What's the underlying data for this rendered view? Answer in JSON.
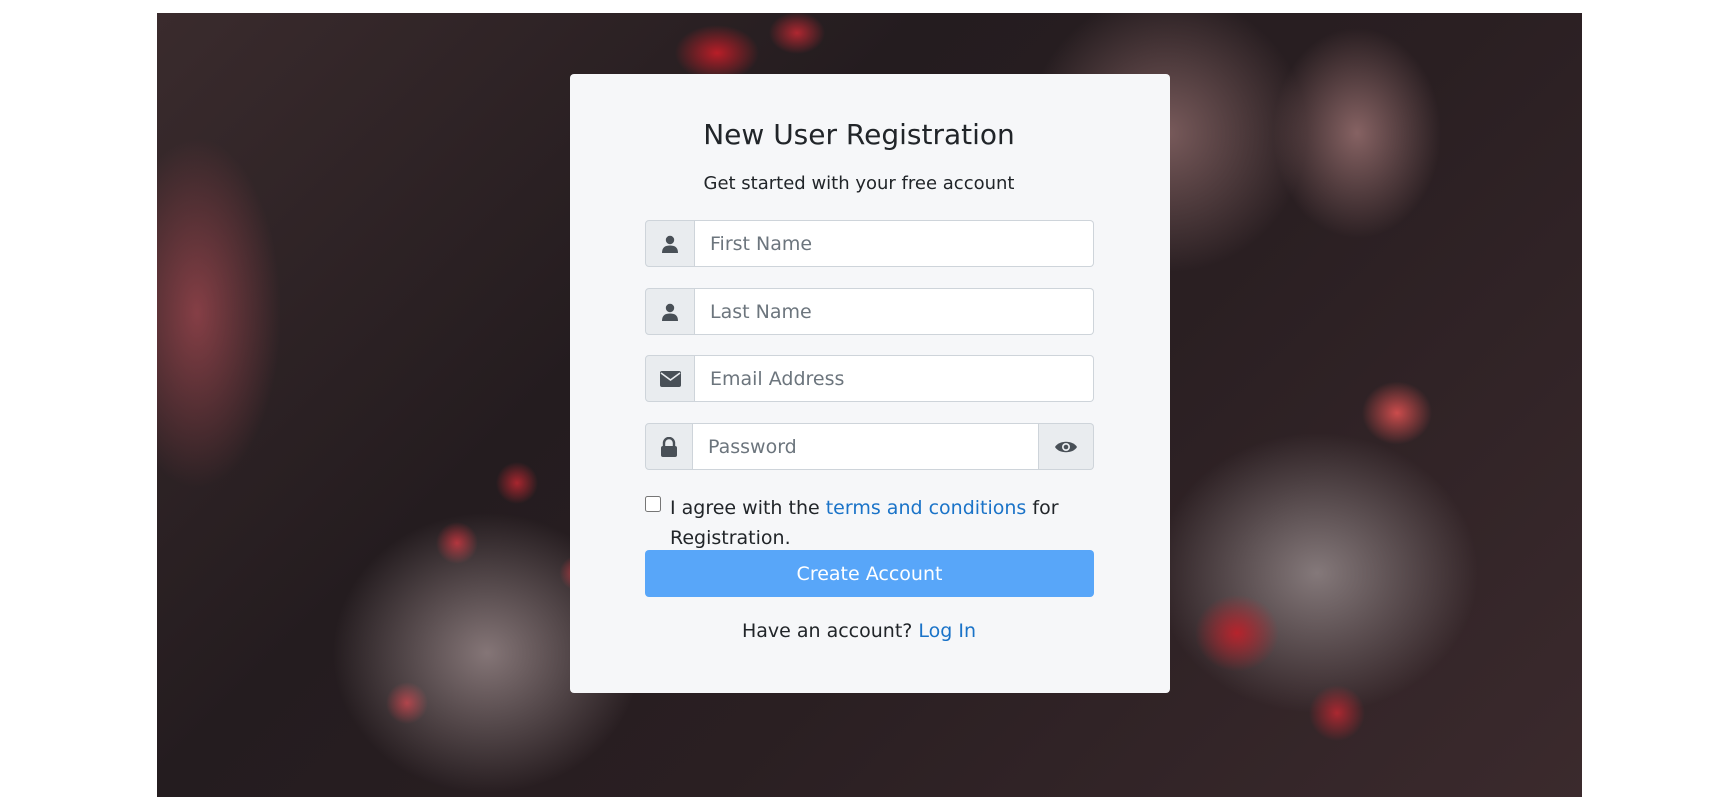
{
  "form": {
    "title": "New User Registration",
    "subtitle": "Get started with your free account",
    "first_name_placeholder": "First Name",
    "last_name_placeholder": "Last Name",
    "email_placeholder": "Email Address",
    "password_placeholder": "Password",
    "agree_prefix": "I agree with the ",
    "terms_link": "terms and conditions",
    "agree_suffix": " for Registration.",
    "submit_label": "Create Account",
    "login_prompt": "Have an account? ",
    "login_link": "Log In"
  },
  "icons": {
    "first_name": "user-icon",
    "last_name": "user-icon",
    "email": "envelope-icon",
    "password": "lock-icon",
    "toggle_password": "eye-icon"
  },
  "colors": {
    "primary_button": "#58a6f9",
    "link": "#1a73c8",
    "card_background": "#f6f7f9"
  }
}
